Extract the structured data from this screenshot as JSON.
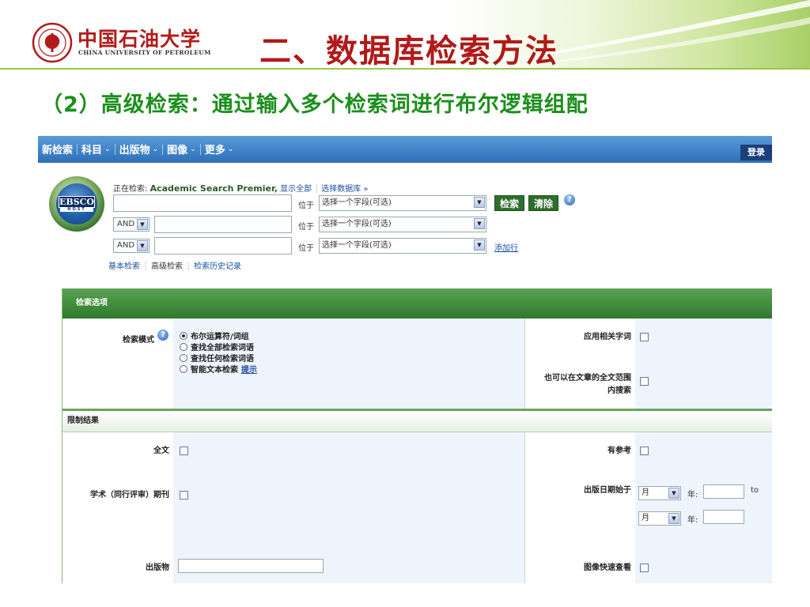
{
  "header": {
    "logo_cn": "中国石油大学",
    "logo_en": "CHINA UNIVERSITY OF PETROLEUM",
    "title": "二、数据库检索方法",
    "subtitle": "（2）高级检索：通过输入多个检索词进行布尔逻辑组配",
    "colors": {
      "title": "#b01a1a",
      "subtitle": "#1b8f1b",
      "accent": "#9cc64e"
    }
  },
  "nav": {
    "items": [
      {
        "label": "新检索"
      },
      {
        "label": "科目"
      },
      {
        "label": "出版物"
      },
      {
        "label": "图像"
      },
      {
        "label": "更多"
      }
    ],
    "login": "登录",
    "colors": {
      "bar": "#2d6fb8"
    }
  },
  "search": {
    "logo_text": "EBSCO",
    "logo_subtext": "HOST",
    "searching_label": "正在检索: ",
    "database": "Academic Search Premier,",
    "show_all": "显示全部",
    "choose_db": "选择数据库 »",
    "in_label": "位于",
    "rows": [
      {
        "op": "",
        "field": "选择一个字段(可选)"
      },
      {
        "op": "AND",
        "field": "选择一个字段(可选)"
      },
      {
        "op": "AND",
        "field": "选择一个字段(可选)"
      }
    ],
    "search_btn": "检索",
    "clear_btn": "清除",
    "add_row": "添加行",
    "modes": [
      "基本检索",
      "高级检索",
      "检索历史记录"
    ]
  },
  "options": {
    "header": "检索选项",
    "mode_label": "检索模式",
    "modes": [
      "布尔运算符/词组",
      "查找全部检索词语",
      "查找任何检索词语",
      "智能文本检索"
    ],
    "hint": "提示",
    "related_words": "应用相关字词",
    "fulltext_search_1": "也可以在文章的全文范围",
    "fulltext_search_2": "内搜索",
    "limit_header": "限制结果",
    "full_text": "全文",
    "scholarly": "学术（同行评审）期刊",
    "publication": "出版物",
    "has_references": "有参考",
    "pub_date": "出版日期始于",
    "month": "月",
    "year": "年:",
    "to": "to",
    "image_quick": "图像快速查看"
  }
}
